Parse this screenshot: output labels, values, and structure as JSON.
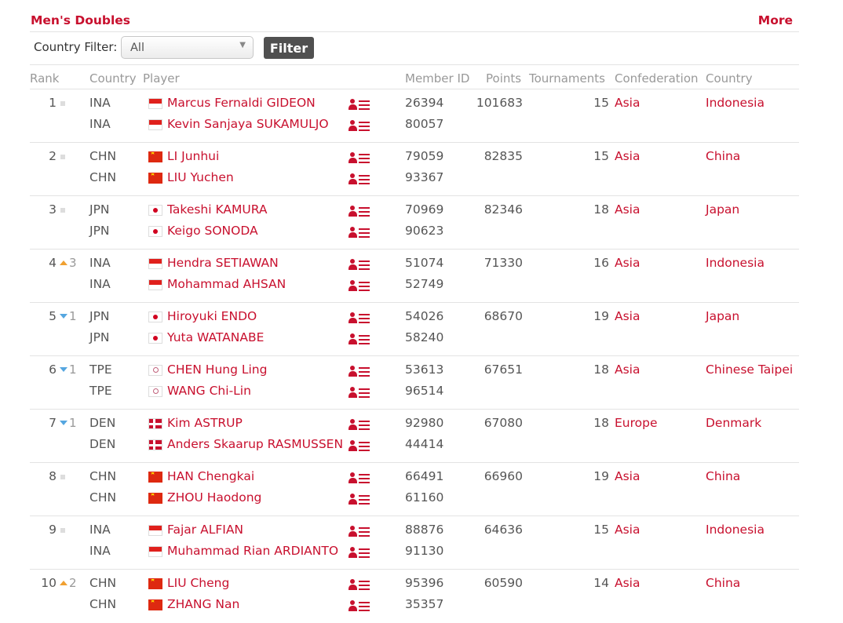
{
  "section": {
    "title": "Men's Doubles",
    "more_label": "More"
  },
  "filter": {
    "label": "Country Filter:",
    "selected": "All",
    "button_label": "Filter"
  },
  "columns": {
    "rank": "Rank",
    "country": "Country",
    "player": "Player",
    "member_id": "Member ID",
    "points": "Points",
    "tournaments": "Tournaments",
    "confederation": "Confederation",
    "country2": "Country"
  },
  "rows": [
    {
      "rank": "1",
      "move": "",
      "dir": "same",
      "points": "101683",
      "tournaments": "15",
      "confederation": "Asia",
      "country": "Indonesia",
      "players": [
        {
          "code": "INA",
          "flag": "id",
          "name": "Marcus Fernaldi GIDEON",
          "member_id": "26394"
        },
        {
          "code": "INA",
          "flag": "id",
          "name": "Kevin Sanjaya SUKAMULJO",
          "member_id": "80057"
        }
      ]
    },
    {
      "rank": "2",
      "move": "",
      "dir": "same",
      "points": "82835",
      "tournaments": "15",
      "confederation": "Asia",
      "country": "China",
      "players": [
        {
          "code": "CHN",
          "flag": "cn",
          "name": "LI Junhui",
          "member_id": "79059"
        },
        {
          "code": "CHN",
          "flag": "cn",
          "name": "LIU Yuchen",
          "member_id": "93367"
        }
      ]
    },
    {
      "rank": "3",
      "move": "",
      "dir": "same",
      "points": "82346",
      "tournaments": "18",
      "confederation": "Asia",
      "country": "Japan",
      "players": [
        {
          "code": "JPN",
          "flag": "jp",
          "name": "Takeshi KAMURA",
          "member_id": "70969"
        },
        {
          "code": "JPN",
          "flag": "jp",
          "name": "Keigo SONODA",
          "member_id": "90623"
        }
      ]
    },
    {
      "rank": "4",
      "move": "3",
      "dir": "up",
      "points": "71330",
      "tournaments": "16",
      "confederation": "Asia",
      "country": "Indonesia",
      "players": [
        {
          "code": "INA",
          "flag": "id",
          "name": "Hendra SETIAWAN",
          "member_id": "51074"
        },
        {
          "code": "INA",
          "flag": "id",
          "name": "Mohammad AHSAN",
          "member_id": "52749"
        }
      ]
    },
    {
      "rank": "5",
      "move": "1",
      "dir": "down",
      "points": "68670",
      "tournaments": "19",
      "confederation": "Asia",
      "country": "Japan",
      "players": [
        {
          "code": "JPN",
          "flag": "jp",
          "name": "Hiroyuki ENDO",
          "member_id": "54026"
        },
        {
          "code": "JPN",
          "flag": "jp",
          "name": "Yuta WATANABE",
          "member_id": "58240"
        }
      ]
    },
    {
      "rank": "6",
      "move": "1",
      "dir": "down",
      "points": "67651",
      "tournaments": "18",
      "confederation": "Asia",
      "country": "Chinese Taipei",
      "players": [
        {
          "code": "TPE",
          "flag": "tw",
          "name": "CHEN Hung Ling",
          "member_id": "53613"
        },
        {
          "code": "TPE",
          "flag": "tw",
          "name": "WANG Chi-Lin",
          "member_id": "96514"
        }
      ]
    },
    {
      "rank": "7",
      "move": "1",
      "dir": "down",
      "points": "67080",
      "tournaments": "18",
      "confederation": "Europe",
      "country": "Denmark",
      "players": [
        {
          "code": "DEN",
          "flag": "dk",
          "name": "Kim ASTRUP",
          "member_id": "92980"
        },
        {
          "code": "DEN",
          "flag": "dk",
          "name": "Anders Skaarup RASMUSSEN",
          "member_id": "44414"
        }
      ]
    },
    {
      "rank": "8",
      "move": "",
      "dir": "same",
      "points": "66960",
      "tournaments": "19",
      "confederation": "Asia",
      "country": "China",
      "players": [
        {
          "code": "CHN",
          "flag": "cn",
          "name": "HAN Chengkai",
          "member_id": "66491"
        },
        {
          "code": "CHN",
          "flag": "cn",
          "name": "ZHOU Haodong",
          "member_id": "61160"
        }
      ]
    },
    {
      "rank": "9",
      "move": "",
      "dir": "same",
      "points": "64636",
      "tournaments": "15",
      "confederation": "Asia",
      "country": "Indonesia",
      "players": [
        {
          "code": "INA",
          "flag": "id",
          "name": "Fajar ALFIAN",
          "member_id": "88876"
        },
        {
          "code": "INA",
          "flag": "id",
          "name": "Muhammad Rian ARDIANTO",
          "member_id": "91130"
        }
      ]
    },
    {
      "rank": "10",
      "move": "2",
      "dir": "up",
      "points": "60590",
      "tournaments": "14",
      "confederation": "Asia",
      "country": "China",
      "players": [
        {
          "code": "CHN",
          "flag": "cn",
          "name": "LIU Cheng",
          "member_id": "95396"
        },
        {
          "code": "CHN",
          "flag": "cn",
          "name": "ZHANG Nan",
          "member_id": "35357"
        }
      ]
    }
  ]
}
